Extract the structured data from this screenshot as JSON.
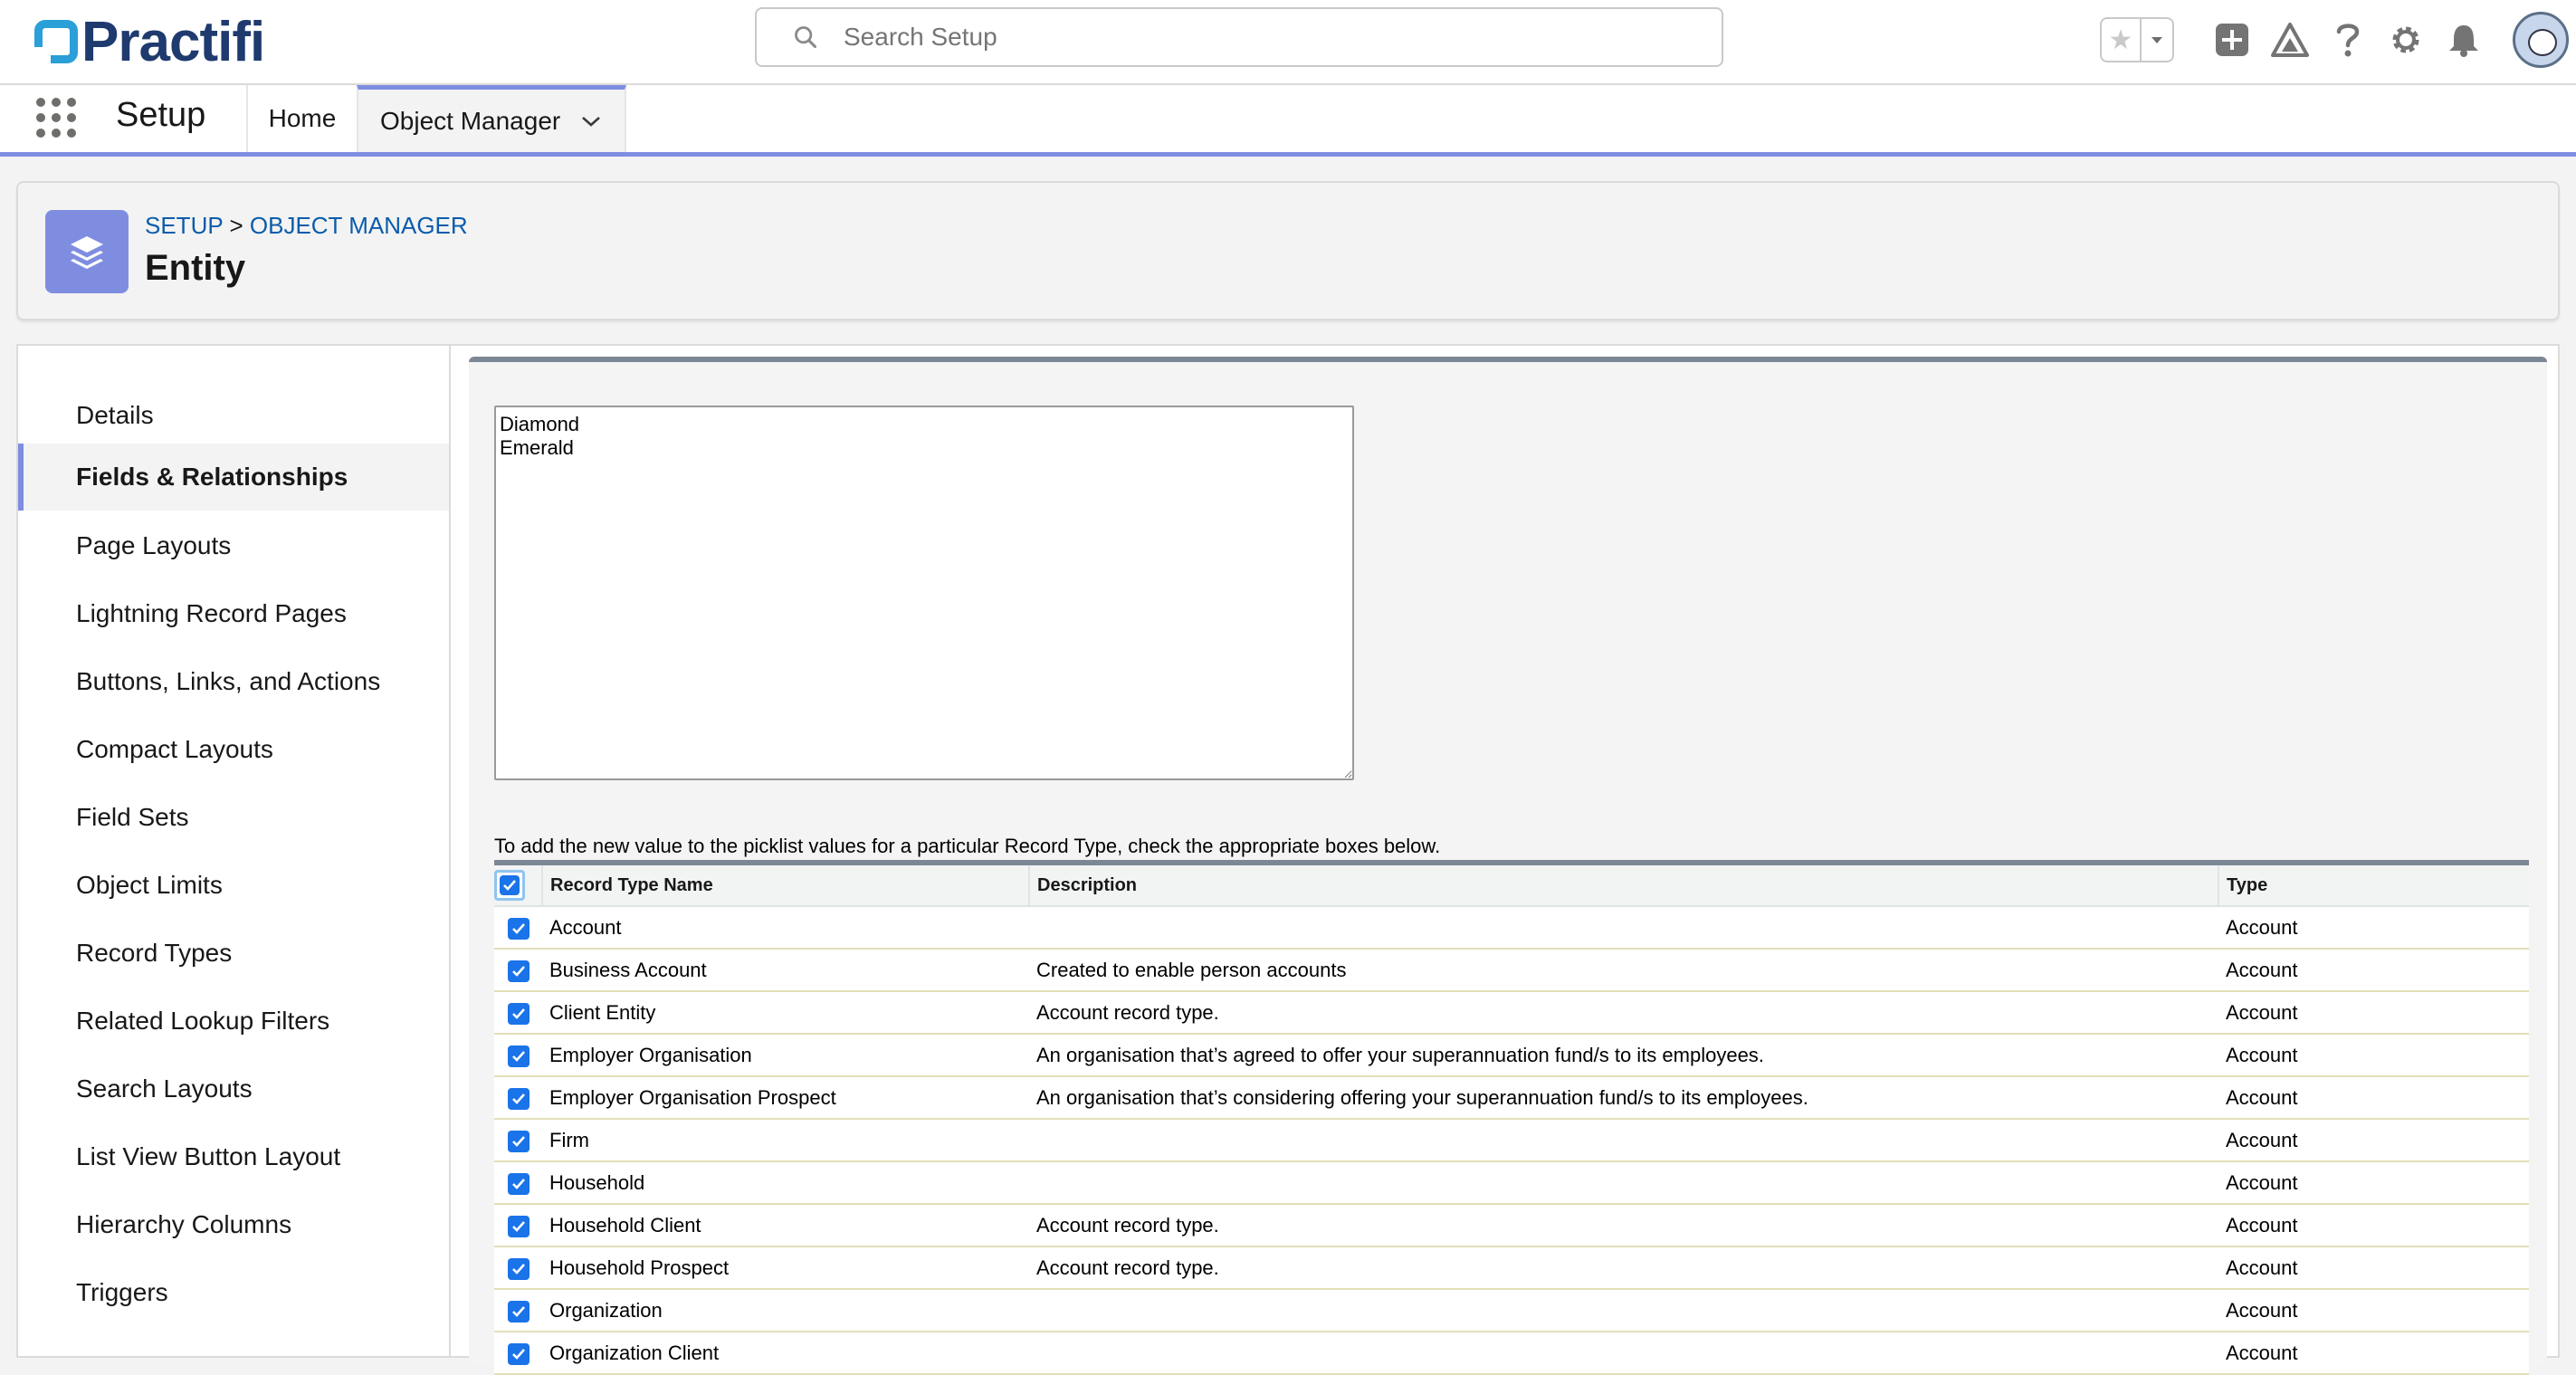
{
  "brand": {
    "name": "Practifi",
    "color": "#1e3a6e",
    "mark_color": "#2a9fd8"
  },
  "search": {
    "placeholder": "Search Setup"
  },
  "nav": {
    "app_name": "Setup",
    "tabs": [
      {
        "label": "Home"
      },
      {
        "label": "Object Manager"
      }
    ]
  },
  "page": {
    "breadcrumb": {
      "setup": "SETUP",
      "separator": ">",
      "object_manager": "OBJECT MANAGER"
    },
    "title": "Entity",
    "icon": "layers-icon",
    "accent": "#7f8de1"
  },
  "sidebar": {
    "items": [
      {
        "label": "Details"
      },
      {
        "label": "Fields & Relationships",
        "active": true
      },
      {
        "label": "Page Layouts"
      },
      {
        "label": "Lightning Record Pages"
      },
      {
        "label": "Buttons, Links, and Actions"
      },
      {
        "label": "Compact Layouts"
      },
      {
        "label": "Field Sets"
      },
      {
        "label": "Object Limits"
      },
      {
        "label": "Record Types"
      },
      {
        "label": "Related Lookup Filters"
      },
      {
        "label": "Search Layouts"
      },
      {
        "label": "List View Button Layout"
      },
      {
        "label": "Hierarchy Columns"
      },
      {
        "label": "Triggers"
      }
    ]
  },
  "picklist": {
    "values_text": "Diamond\nEmerald"
  },
  "record_types": {
    "instruction": "To add the new value to the picklist values for a particular Record Type, check the appropriate boxes below.",
    "headers": {
      "name": "Record Type Name",
      "description": "Description",
      "type": "Type"
    },
    "select_all_checked": true,
    "rows": [
      {
        "checked": true,
        "name": "Account",
        "description": "",
        "type": "Account"
      },
      {
        "checked": true,
        "name": "Business Account",
        "description": "Created to enable person accounts",
        "type": "Account"
      },
      {
        "checked": true,
        "name": "Client Entity",
        "description": "Account record type.",
        "type": "Account"
      },
      {
        "checked": true,
        "name": "Employer Organisation",
        "description": "An organisation that’s agreed to offer your superannuation fund/s to its employees.",
        "type": "Account"
      },
      {
        "checked": true,
        "name": "Employer Organisation Prospect",
        "description": "An organisation that’s considering offering your superannuation fund/s to its employees.",
        "type": "Account"
      },
      {
        "checked": true,
        "name": "Firm",
        "description": "",
        "type": "Account"
      },
      {
        "checked": true,
        "name": "Household",
        "description": "",
        "type": "Account"
      },
      {
        "checked": true,
        "name": "Household Client",
        "description": "Account record type.",
        "type": "Account"
      },
      {
        "checked": true,
        "name": "Household Prospect",
        "description": "Account record type.",
        "type": "Account"
      },
      {
        "checked": true,
        "name": "Organization",
        "description": "",
        "type": "Account"
      },
      {
        "checked": true,
        "name": "Organization Client",
        "description": "",
        "type": "Account"
      }
    ]
  }
}
